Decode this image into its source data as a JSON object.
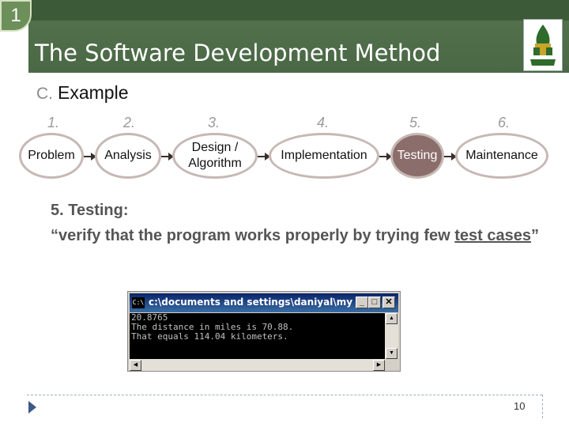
{
  "slide": {
    "badge_number": "1",
    "title": "The Software Development Method",
    "subtitle_letter": "C.",
    "subtitle": "Example",
    "page_number": "10"
  },
  "steps": [
    {
      "number": "1.",
      "label": "Problem",
      "active": false
    },
    {
      "number": "2.",
      "label": "Analysis",
      "active": false
    },
    {
      "number": "3.",
      "label": "Design / Algorithm",
      "active": false
    },
    {
      "number": "4.",
      "label": "Implementation",
      "active": false
    },
    {
      "number": "5.",
      "label": "Testing",
      "active": true
    },
    {
      "number": "6.",
      "label": "Maintenance",
      "active": false
    }
  ],
  "description": {
    "heading": "5. Testing:",
    "quote_start": "“verify that the program works properly by trying few ",
    "quote_link": "test cases",
    "quote_end": "”"
  },
  "console_window": {
    "title": "c:\\documents and settings\\daniyal\\my doc...",
    "icon_label": "C:\\",
    "lines": [
      "20.8765",
      "The distance in miles is 70.88.",
      "That equals 114.04 kilometers."
    ],
    "minimize": "_",
    "maximize": "□",
    "close": "✕"
  },
  "colors": {
    "header_green": "#4a6845",
    "active_step": "#8b6e6c",
    "step_border": "#c6b8b4"
  }
}
